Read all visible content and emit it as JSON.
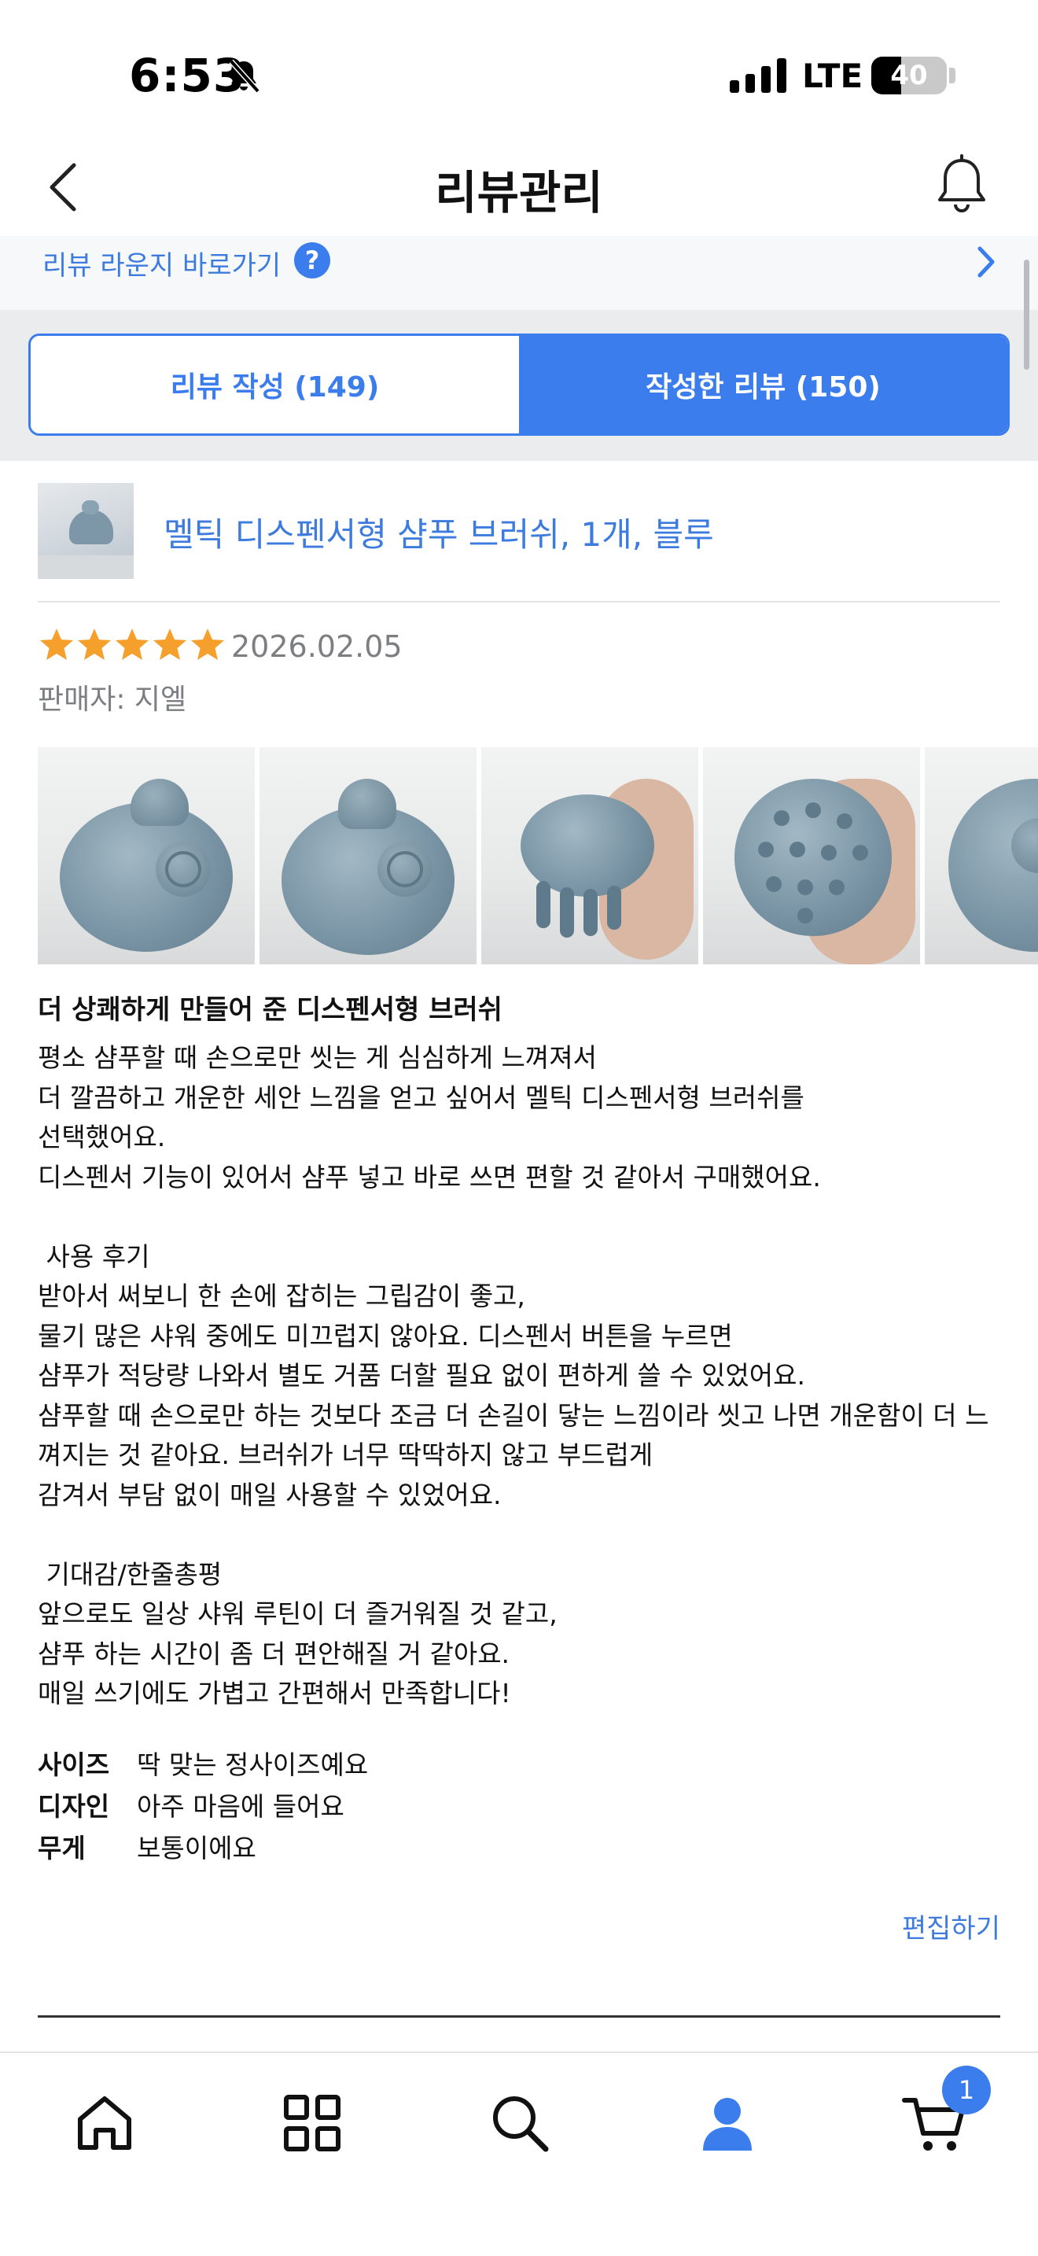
{
  "status_bar": {
    "time": "6:53",
    "network": "LTE",
    "battery": "40",
    "battery_level": 0.4
  },
  "header": {
    "title": "리뷰관리",
    "back_icon": "chevron-left-icon",
    "right_icon": "bell-icon"
  },
  "lounge": {
    "label": "리뷰 라운지 바로가기",
    "help_icon": "?"
  },
  "tabs": [
    {
      "label": "리뷰 작성 (149)",
      "active": false
    },
    {
      "label": "작성한 리뷰 (150)",
      "active": true
    }
  ],
  "review": {
    "product_name": "멜틱 디스펜서형 샴푸 브러쉬, 1개, 블루",
    "rating": 5,
    "rating_max": 5,
    "date": "2026.02.05",
    "seller": "판매자: 지엘",
    "photo_count_visible": 5,
    "title": "더 상쾌하게 만들어 준 디스펜서형 브러쉬",
    "body": "평소 샴푸할 때 손으로만 씻는 게 심심하게 느껴져서\n더 깔끔하고 개운한 세안 느낌을 얻고 싶어서 멜틱 디스펜서형 브러쉬를\n선택했어요.\n디스펜서 기능이 있어서 샴푸 넣고 바로 쓰면 편할 것 같아서 구매했어요.\n\n 사용 후기\n받아서 써보니 한 손에 잡히는 그립감이 좋고,\n물기 많은 샤워 중에도 미끄럽지 않아요. 디스펜서 버튼을 누르면\n샴푸가 적당량 나와서 별도 거품 더할 필요 없이 편하게 쓸 수 있었어요.\n샴푸할 때 손으로만 하는 것보다 조금 더 손길이 닿는 느낌이라 씻고 나면 개운함이 더 느\n껴지는 것 같아요. 브러쉬가 너무 딱딱하지 않고 부드럽게\n감겨서 부담 없이 매일 사용할 수 있었어요.\n\n 기대감/한줄총평\n앞으로도 일상 샤워 루틴이 더 즐거워질 것 같고,\n샴푸 하는 시간이 좀 더 편안해질 거 같아요.\n매일 쓰기에도 가볍고 간편해서 만족합니다!",
    "attributes": [
      {
        "key": "사이즈",
        "value": "딱 맞는 정사이즈예요"
      },
      {
        "key": "디자인",
        "value": "아주 마음에 들어요"
      },
      {
        "key": "무게",
        "value": "보통이에요"
      }
    ],
    "edit_label": "편집하기"
  },
  "bottom_nav": {
    "items": [
      "home-icon",
      "grid-icon",
      "search-icon",
      "user-icon",
      "cart-icon"
    ],
    "active": "user-icon",
    "cart_count": "1"
  },
  "colors": {
    "accent": "#3b7ded",
    "link": "#3d7bdf",
    "star": "#f5a02c",
    "muted": "#7c7e82"
  }
}
